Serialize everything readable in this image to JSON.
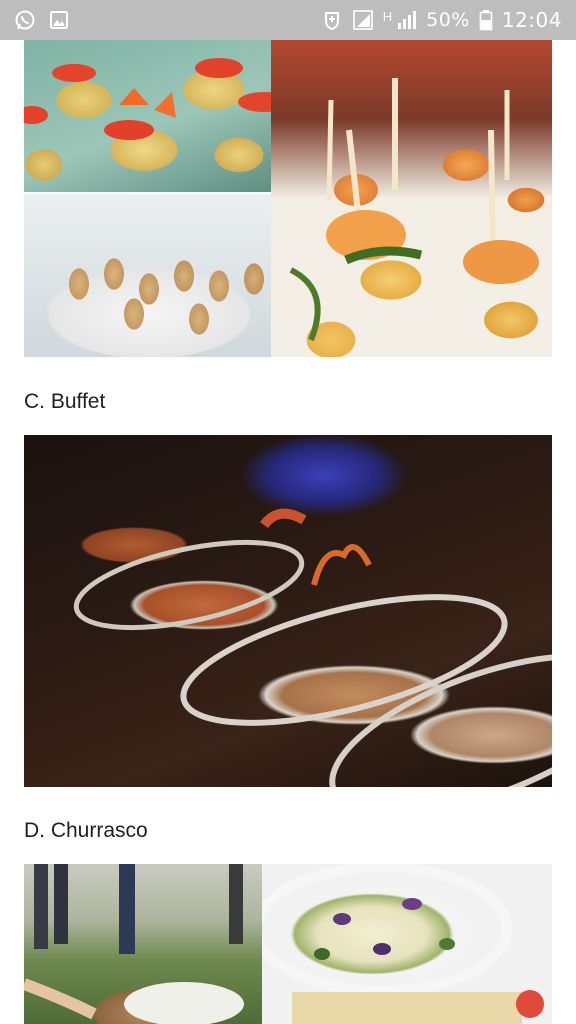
{
  "status_bar": {
    "left_icons": [
      "whatsapp-icon",
      "gallery-icon"
    ],
    "right_icons": [
      "data-saver-icon",
      "signal-sim1-icon",
      "hplus-icon",
      "signal-sim2-icon",
      "battery-icon"
    ],
    "hplus_text": "H",
    "battery_percent": "50%",
    "time": "12:04",
    "background_color": "#bdbdbd"
  },
  "sections": [
    {
      "label": "C. Buffet"
    },
    {
      "label": "D. Churrasco"
    }
  ],
  "photos": [
    {
      "subject": "canapes"
    },
    {
      "subject": "shrimp-skewers"
    },
    {
      "subject": "cones"
    },
    {
      "subject": "buffet"
    },
    {
      "subject": "churrasco"
    },
    {
      "subject": "salad"
    }
  ]
}
